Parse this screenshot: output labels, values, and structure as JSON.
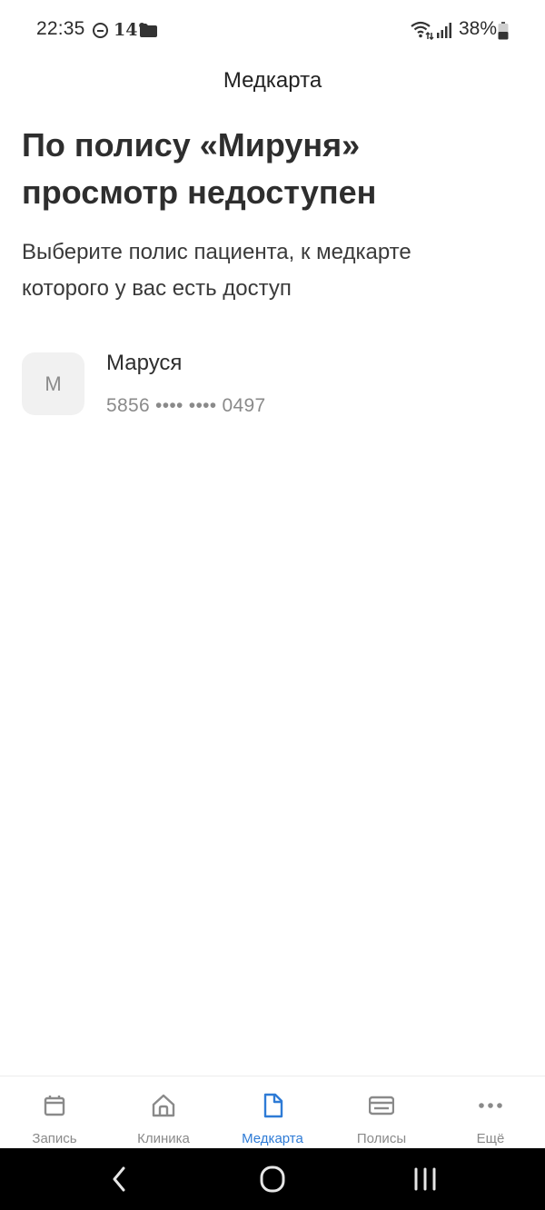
{
  "status_bar": {
    "time": "22:35",
    "temperature": "14°",
    "battery": "38%"
  },
  "header": {
    "title": "Медкарта"
  },
  "main": {
    "heading_line1": "По полису «Мируня»",
    "heading_line2": "просмотр недоступен",
    "subtitle_line1": "Выберите полис пациента, к медкарте",
    "subtitle_line2": "которого у вас есть доступ"
  },
  "patients": [
    {
      "initial": "М",
      "name": "Маруся",
      "policy": "5856 •••• •••• 0497"
    }
  ],
  "tab_bar": {
    "active_color": "#2e7bd6",
    "inactive_color": "#8a8a8a",
    "tabs": [
      {
        "label": "Запись",
        "icon": "calendar-icon"
      },
      {
        "label": "Клиника",
        "icon": "home-icon"
      },
      {
        "label": "Медкарта",
        "icon": "document-icon"
      },
      {
        "label": "Полисы",
        "icon": "card-icon"
      },
      {
        "label": "Ещё",
        "icon": "more-icon"
      }
    ]
  },
  "nav_bar": {
    "buttons": [
      "back-icon",
      "home-circle-icon",
      "recents-icon"
    ]
  }
}
